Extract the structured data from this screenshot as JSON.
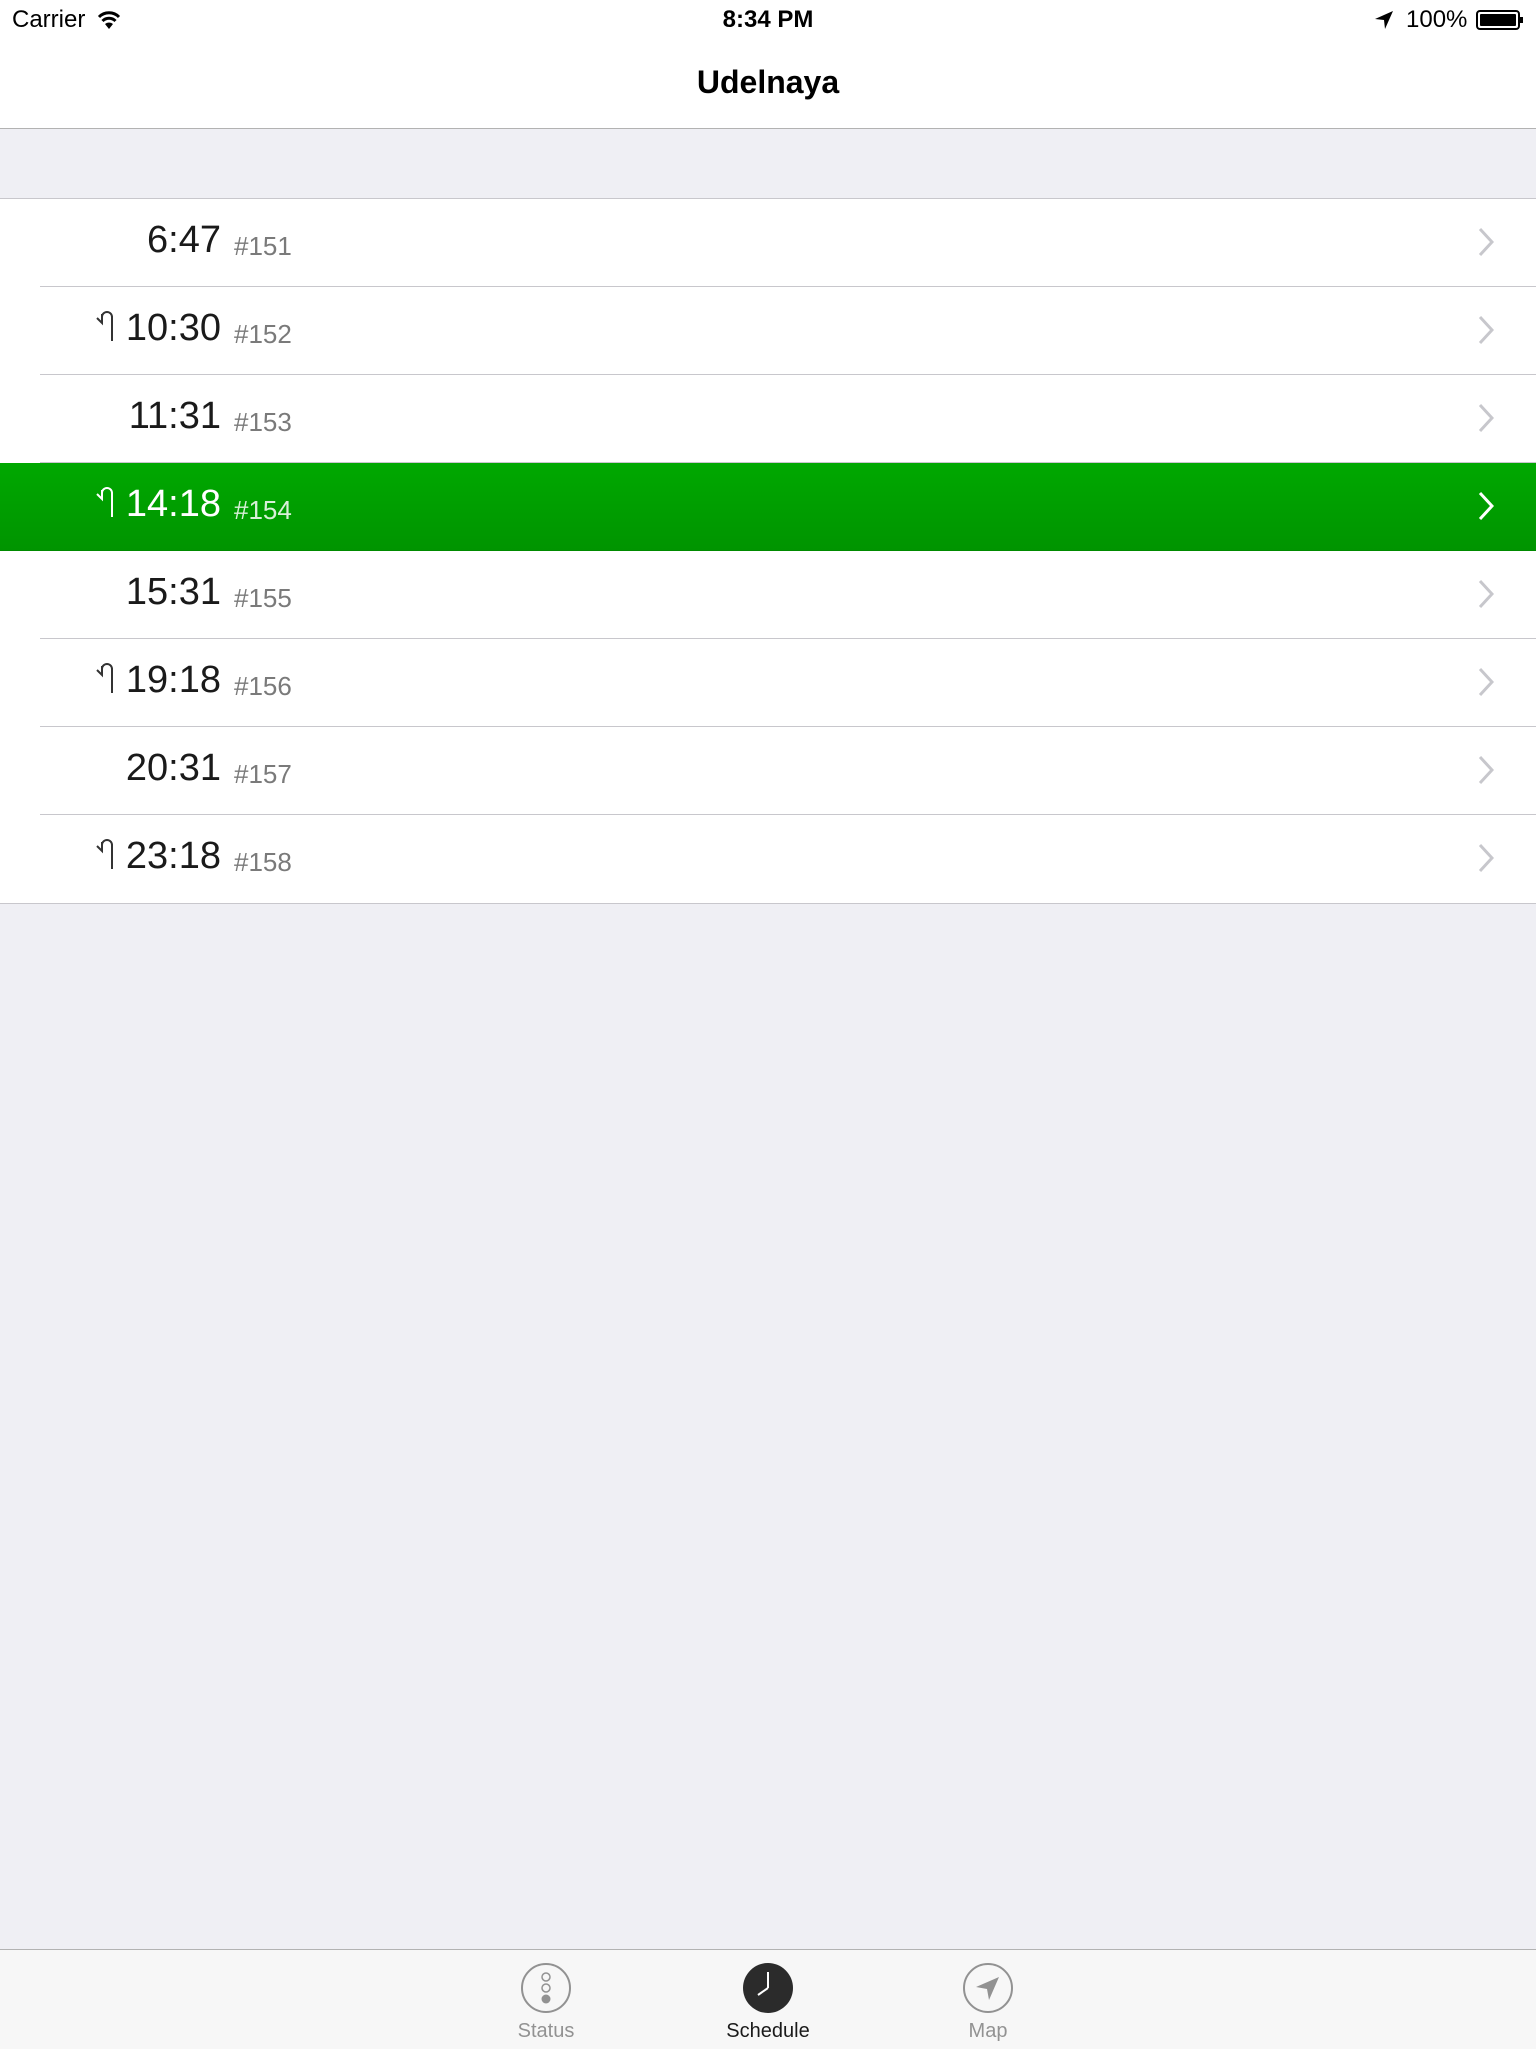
{
  "status_bar": {
    "carrier": "Carrier",
    "time": "8:34 PM",
    "battery": "100%"
  },
  "nav": {
    "title": "Udelnaya"
  },
  "schedule": [
    {
      "time": "6:47",
      "number": "#151",
      "turn": false,
      "highlight": false
    },
    {
      "time": "10:30",
      "number": "#152",
      "turn": true,
      "highlight": false
    },
    {
      "time": "11:31",
      "number": "#153",
      "turn": false,
      "highlight": false
    },
    {
      "time": "14:18",
      "number": "#154",
      "turn": true,
      "highlight": true
    },
    {
      "time": "15:31",
      "number": "#155",
      "turn": false,
      "highlight": false
    },
    {
      "time": "19:18",
      "number": "#156",
      "turn": true,
      "highlight": false
    },
    {
      "time": "20:31",
      "number": "#157",
      "turn": false,
      "highlight": false
    },
    {
      "time": "23:18",
      "number": "#158",
      "turn": true,
      "highlight": false
    }
  ],
  "tabs": [
    {
      "label": "Status",
      "icon": "traffic-light-icon",
      "active": false
    },
    {
      "label": "Schedule",
      "icon": "clock-icon",
      "active": true
    },
    {
      "label": "Map",
      "icon": "location-arrow-icon",
      "active": false
    }
  ],
  "colors": {
    "highlight": "#00a000",
    "background": "#efeff4"
  }
}
